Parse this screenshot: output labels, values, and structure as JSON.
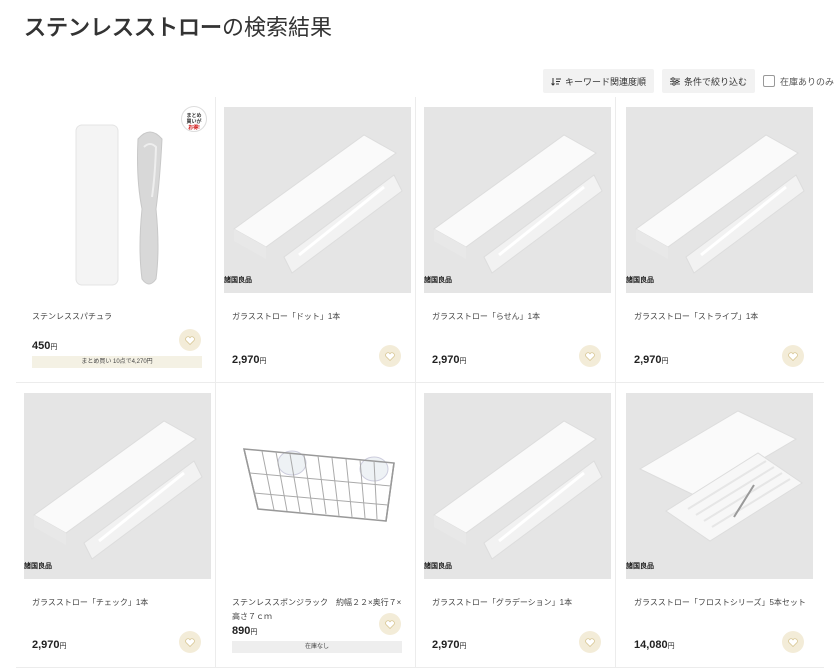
{
  "header": {
    "keyword": "ステンレスストロー",
    "suffix": "の検索結果"
  },
  "toolbar": {
    "sort_label": "キーワード関連度順",
    "filter_label": "条件で絞り込む",
    "stock_label": "在庫ありのみ"
  },
  "products": [
    {
      "name": "ステンレススパチュラ",
      "price": "450",
      "yen": "円",
      "brand": "",
      "note": "まとめ買い 10点で4,270円",
      "badge": [
        "まとめ",
        "買いが",
        "お得!"
      ]
    },
    {
      "name": "ガラスストロー「ドット」1本",
      "price": "2,970",
      "yen": "円",
      "brand": "諸国良品"
    },
    {
      "name": "ガラスストロー「らせん」1本",
      "price": "2,970",
      "yen": "円",
      "brand": "諸国良品"
    },
    {
      "name": "ガラスストロー「ストライプ」1本",
      "price": "2,970",
      "yen": "円",
      "brand": "諸国良品"
    },
    {
      "name": "ガラスストロー「チェック」1本",
      "price": "2,970",
      "yen": "円",
      "brand": "諸国良品"
    },
    {
      "name": "ステンレススポンジラック　約幅２２×奥行７×高さ７ｃｍ",
      "price": "890",
      "yen": "円",
      "brand": "",
      "note": "在庫なし"
    },
    {
      "name": "ガラスストロー「グラデーション」1本",
      "price": "2,970",
      "yen": "円",
      "brand": "諸国良品"
    },
    {
      "name": "ガラスストロー「フロストシリーズ」5本セット",
      "price": "14,080",
      "yen": "円",
      "brand": "諸国良品"
    }
  ]
}
